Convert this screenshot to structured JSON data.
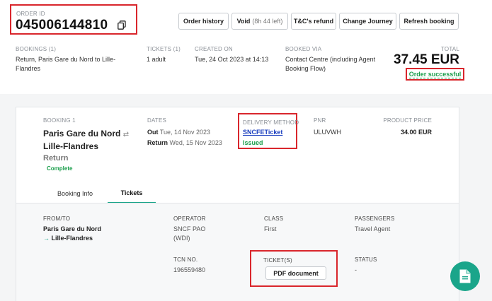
{
  "header": {
    "order_id_label": "ORDER ID",
    "order_id": "045006144810",
    "copy_icon": "copy-icon",
    "buttons": {
      "order_history": "Order history",
      "void": "Void",
      "void_time": "(8h 44 left)",
      "tc_refund": "T&C's refund",
      "change_journey": "Change Journey",
      "refresh_booking": "Refresh booking"
    }
  },
  "summary": {
    "bookings_label": "BOOKINGS (1)",
    "bookings_value": "Return, Paris Gare du Nord to Lille-Flandres",
    "tickets_label": "TICKETS (1)",
    "tickets_value": "1 adult",
    "created_label": "CREATED ON",
    "created_value": "Tue, 24 Oct 2023 at 14:13",
    "booked_via_label": "BOOKED VIA",
    "booked_via_value": "Contact Centre (including Agent Booking Flow)",
    "total_label": "TOTAL",
    "total_value": "37.45 EUR",
    "order_status": "Order successful"
  },
  "booking": {
    "label": "BOOKING 1",
    "origin": "Paris Gare du Nord",
    "swap_icon": "swap-arrows-icon",
    "destination": "Lille-Flandres",
    "type": "Return",
    "status": "Complete",
    "dates_label": "DATES",
    "out_label": "Out",
    "out_date": "Tue, 14 Nov 2023",
    "return_label": "Return",
    "return_date": "Wed, 15 Nov 2023",
    "delivery_label": "DELIVERY METHOD",
    "delivery_method": "SNCFETicket",
    "delivery_status": "Issued",
    "pnr_label": "PNR",
    "pnr_value": "ULUVWH",
    "price_label": "PRODUCT PRICE",
    "price_value": "34.00 EUR"
  },
  "tabs": [
    "Booking Info",
    "Tickets"
  ],
  "active_tab": "Tickets",
  "ticket": {
    "from_to_label": "FROM/TO",
    "from": "Paris Gare du Nord",
    "to_arrow": "→",
    "to": "Lille-Flandres",
    "operator_label": "OPERATOR",
    "operator_value": "SNCF PAO (WDI)",
    "class_label": "CLASS",
    "class_value": "First",
    "passengers_label": "PASSENGERS",
    "passengers_value": "Travel Agent",
    "tcn_label": "TCN NO.",
    "tcn_value": "196559480",
    "tickets_label": "TICKET(S)",
    "pdf_button": "PDF document",
    "status_label": "STATUS",
    "status_value": "-"
  },
  "fab_icon": "document-icon",
  "colors": {
    "accent": "#1aa58a",
    "success": "#1a9e4b",
    "link": "#1b3fbf",
    "highlight": "#d9262c"
  }
}
